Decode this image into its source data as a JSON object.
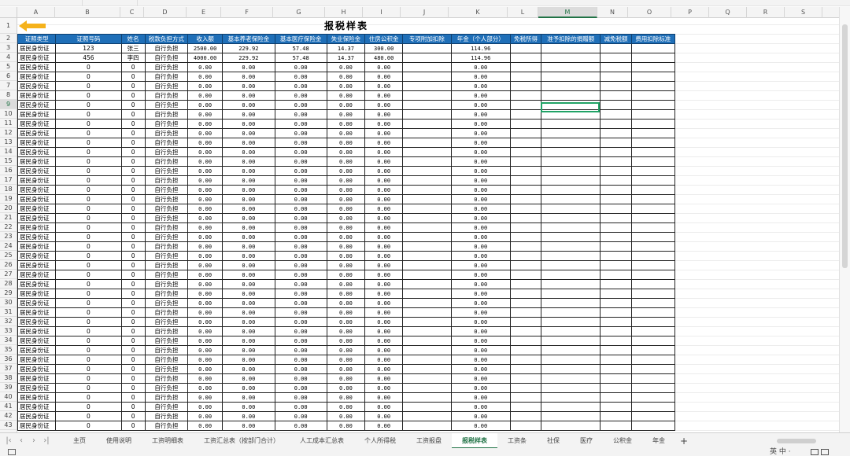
{
  "app": {
    "active_sheet": "报税样表"
  },
  "columns": [
    "A",
    "B",
    "C",
    "D",
    "E",
    "F",
    "G",
    "H",
    "I",
    "J",
    "K",
    "L",
    "M",
    "N",
    "O",
    "P",
    "Q",
    "R",
    "S"
  ],
  "selected_column": "M",
  "selected_row": "9",
  "sheet": {
    "title": "报税样表",
    "headers": [
      "证照类型",
      "证照号码",
      "姓名",
      "税款负担方式",
      "收入额",
      "基本养老保险金",
      "基本医疗保险金",
      "失业保险金",
      "住房公积金",
      "专项附加扣除",
      "年金（个人部分）",
      "免税所得",
      "准予扣除的捐赠额",
      "减免税额",
      "费用扣除标准"
    ],
    "rows": [
      [
        "居民身份证",
        "123",
        "张三",
        "自行负担",
        "2500.00",
        "229.92",
        "57.48",
        "14.37",
        "300.00",
        "",
        "114.96",
        "",
        "",
        "",
        ""
      ],
      [
        "居民身份证",
        "456",
        "李四",
        "自行负担",
        "4000.00",
        "229.92",
        "57.48",
        "14.37",
        "480.00",
        "",
        "114.96",
        "",
        "",
        "",
        ""
      ],
      [
        "居民身份证",
        "0",
        "0",
        "自行负担",
        "0.00",
        "0.00",
        "0.00",
        "0.00",
        "0.00",
        "",
        "0.00",
        "",
        "",
        "",
        ""
      ],
      [
        "居民身份证",
        "0",
        "0",
        "自行负担",
        "0.00",
        "0.00",
        "0.00",
        "0.00",
        "0.00",
        "",
        "0.00",
        "",
        "",
        "",
        ""
      ],
      [
        "居民身份证",
        "0",
        "0",
        "自行负担",
        "0.00",
        "0.00",
        "0.00",
        "0.00",
        "0.00",
        "",
        "0.00",
        "",
        "",
        "",
        ""
      ],
      [
        "居民身份证",
        "0",
        "0",
        "自行负担",
        "0.00",
        "0.00",
        "0.00",
        "0.00",
        "0.00",
        "",
        "0.00",
        "",
        "",
        "",
        ""
      ],
      [
        "居民身份证",
        "0",
        "0",
        "自行负担",
        "0.00",
        "0.00",
        "0.00",
        "0.00",
        "0.00",
        "",
        "0.00",
        "",
        "",
        "",
        ""
      ],
      [
        "居民身份证",
        "0",
        "0",
        "自行负担",
        "0.00",
        "0.00",
        "0.00",
        "0.00",
        "0.00",
        "",
        "0.00",
        "",
        "",
        "",
        ""
      ],
      [
        "居民身份证",
        "0",
        "0",
        "自行负担",
        "0.00",
        "0.00",
        "0.00",
        "0.00",
        "0.00",
        "",
        "0.00",
        "",
        "",
        "",
        ""
      ],
      [
        "居民身份证",
        "0",
        "0",
        "自行负担",
        "0.00",
        "0.00",
        "0.00",
        "0.00",
        "0.00",
        "",
        "0.00",
        "",
        "",
        "",
        ""
      ],
      [
        "居民身份证",
        "0",
        "0",
        "自行负担",
        "0.00",
        "0.00",
        "0.00",
        "0.00",
        "0.00",
        "",
        "0.00",
        "",
        "",
        "",
        ""
      ],
      [
        "居民身份证",
        "0",
        "0",
        "自行负担",
        "0.00",
        "0.00",
        "0.00",
        "0.00",
        "0.00",
        "",
        "0.00",
        "",
        "",
        "",
        ""
      ],
      [
        "居民身份证",
        "0",
        "0",
        "自行负担",
        "0.00",
        "0.00",
        "0.00",
        "0.00",
        "0.00",
        "",
        "0.00",
        "",
        "",
        "",
        ""
      ],
      [
        "居民身份证",
        "0",
        "0",
        "自行负担",
        "0.00",
        "0.00",
        "0.00",
        "0.00",
        "0.00",
        "",
        "0.00",
        "",
        "",
        "",
        ""
      ],
      [
        "居民身份证",
        "0",
        "0",
        "自行负担",
        "0.00",
        "0.00",
        "0.00",
        "0.00",
        "0.00",
        "",
        "0.00",
        "",
        "",
        "",
        ""
      ],
      [
        "居民身份证",
        "0",
        "0",
        "自行负担",
        "0.00",
        "0.00",
        "0.00",
        "0.00",
        "0.00",
        "",
        "0.00",
        "",
        "",
        "",
        ""
      ],
      [
        "居民身份证",
        "0",
        "0",
        "自行负担",
        "0.00",
        "0.00",
        "0.00",
        "0.00",
        "0.00",
        "",
        "0.00",
        "",
        "",
        "",
        ""
      ],
      [
        "居民身份证",
        "0",
        "0",
        "自行负担",
        "0.00",
        "0.00",
        "0.00",
        "0.00",
        "0.00",
        "",
        "0.00",
        "",
        "",
        "",
        ""
      ],
      [
        "居民身份证",
        "0",
        "0",
        "自行负担",
        "0.00",
        "0.00",
        "0.00",
        "0.00",
        "0.00",
        "",
        "0.00",
        "",
        "",
        "",
        ""
      ],
      [
        "居民身份证",
        "0",
        "0",
        "自行负担",
        "0.00",
        "0.00",
        "0.00",
        "0.00",
        "0.00",
        "",
        "0.00",
        "",
        "",
        "",
        ""
      ],
      [
        "居民身份证",
        "0",
        "0",
        "自行负担",
        "0.00",
        "0.00",
        "0.00",
        "0.00",
        "0.00",
        "",
        "0.00",
        "",
        "",
        "",
        ""
      ],
      [
        "居民身份证",
        "0",
        "0",
        "自行负担",
        "0.00",
        "0.00",
        "0.00",
        "0.00",
        "0.00",
        "",
        "0.00",
        "",
        "",
        "",
        ""
      ],
      [
        "居民身份证",
        "0",
        "0",
        "自行负担",
        "0.00",
        "0.00",
        "0.00",
        "0.00",
        "0.00",
        "",
        "0.00",
        "",
        "",
        "",
        ""
      ],
      [
        "居民身份证",
        "0",
        "0",
        "自行负担",
        "0.00",
        "0.00",
        "0.00",
        "0.00",
        "0.00",
        "",
        "0.00",
        "",
        "",
        "",
        ""
      ],
      [
        "居民身份证",
        "0",
        "0",
        "自行负担",
        "0.00",
        "0.00",
        "0.00",
        "0.00",
        "0.00",
        "",
        "0.00",
        "",
        "",
        "",
        ""
      ],
      [
        "居民身份证",
        "0",
        "0",
        "自行负担",
        "0.00",
        "0.00",
        "0.00",
        "0.00",
        "0.00",
        "",
        "0.00",
        "",
        "",
        "",
        ""
      ],
      [
        "居民身份证",
        "0",
        "0",
        "自行负担",
        "0.00",
        "0.00",
        "0.00",
        "0.00",
        "0.00",
        "",
        "0.00",
        "",
        "",
        "",
        ""
      ],
      [
        "居民身份证",
        "0",
        "0",
        "自行负担",
        "0.00",
        "0.00",
        "0.00",
        "0.00",
        "0.00",
        "",
        "0.00",
        "",
        "",
        "",
        ""
      ],
      [
        "居民身份证",
        "0",
        "0",
        "自行负担",
        "0.00",
        "0.00",
        "0.00",
        "0.00",
        "0.00",
        "",
        "0.00",
        "",
        "",
        "",
        ""
      ],
      [
        "居民身份证",
        "0",
        "0",
        "自行负担",
        "0.00",
        "0.00",
        "0.00",
        "0.00",
        "0.00",
        "",
        "0.00",
        "",
        "",
        "",
        ""
      ],
      [
        "居民身份证",
        "0",
        "0",
        "自行负担",
        "0.00",
        "0.00",
        "0.00",
        "0.00",
        "0.00",
        "",
        "0.00",
        "",
        "",
        "",
        ""
      ],
      [
        "居民身份证",
        "0",
        "0",
        "自行负担",
        "0.00",
        "0.00",
        "0.00",
        "0.00",
        "0.00",
        "",
        "0.00",
        "",
        "",
        "",
        ""
      ],
      [
        "居民身份证",
        "0",
        "0",
        "自行负担",
        "0.00",
        "0.00",
        "0.00",
        "0.00",
        "0.00",
        "",
        "0.00",
        "",
        "",
        "",
        ""
      ],
      [
        "居民身份证",
        "0",
        "0",
        "自行负担",
        "0.00",
        "0.00",
        "0.00",
        "0.00",
        "0.00",
        "",
        "0.00",
        "",
        "",
        "",
        ""
      ],
      [
        "居民身份证",
        "0",
        "0",
        "自行负担",
        "0.00",
        "0.00",
        "0.00",
        "0.00",
        "0.00",
        "",
        "0.00",
        "",
        "",
        "",
        ""
      ],
      [
        "居民身份证",
        "0",
        "0",
        "自行负担",
        "0.00",
        "0.00",
        "0.00",
        "0.00",
        "0.00",
        "",
        "0.00",
        "",
        "",
        "",
        ""
      ],
      [
        "居民身份证",
        "0",
        "0",
        "自行负担",
        "0.00",
        "0.00",
        "0.00",
        "0.00",
        "0.00",
        "",
        "0.00",
        "",
        "",
        "",
        ""
      ],
      [
        "居民身份证",
        "0",
        "0",
        "自行负担",
        "0.00",
        "0.00",
        "0.00",
        "0.00",
        "0.00",
        "",
        "0.00",
        "",
        "",
        "",
        ""
      ],
      [
        "居民身份证",
        "0",
        "0",
        "自行负担",
        "0.00",
        "0.00",
        "0.00",
        "0.00",
        "0.00",
        "",
        "0.00",
        "",
        "",
        "",
        ""
      ],
      [
        "居民身份证",
        "0",
        "0",
        "自行负担",
        "0.00",
        "0.00",
        "0.00",
        "0.00",
        "0.00",
        "",
        "0.00",
        "",
        "",
        "",
        ""
      ],
      [
        "居民身份证",
        "0",
        "0",
        "自行负担",
        "0.00",
        "0.00",
        "0.00",
        "0.00",
        "0.00",
        "",
        "0.00",
        "",
        "",
        "",
        ""
      ]
    ]
  },
  "row_numbers": [
    "1",
    "2",
    "3",
    "4",
    "5",
    "6",
    "7",
    "8",
    "9",
    "10",
    "11",
    "12",
    "13",
    "14",
    "15",
    "16",
    "17",
    "18",
    "19",
    "20",
    "21",
    "22",
    "23",
    "24",
    "25",
    "26",
    "27",
    "28",
    "29",
    "30",
    "31",
    "32",
    "33",
    "34",
    "35",
    "36",
    "37",
    "38",
    "39",
    "40",
    "41",
    "42",
    "43"
  ],
  "tabs": [
    "主页",
    "使用说明",
    "工资明细表",
    "工资汇总表（按部门合计）",
    "人工成本汇总表",
    "个人所得税",
    "工资报盘",
    "报税样表",
    "工资条",
    "社保",
    "医疗",
    "公积金",
    "年金"
  ],
  "tab_add": "+",
  "status": {
    "ime": "英 中 ·"
  },
  "colors": {
    "header_blue": "#1f6fb8",
    "accent_green": "#217346",
    "arrow_yellow": "#f5b21b"
  },
  "icons": {
    "arrow": "arrow-left-icon"
  }
}
